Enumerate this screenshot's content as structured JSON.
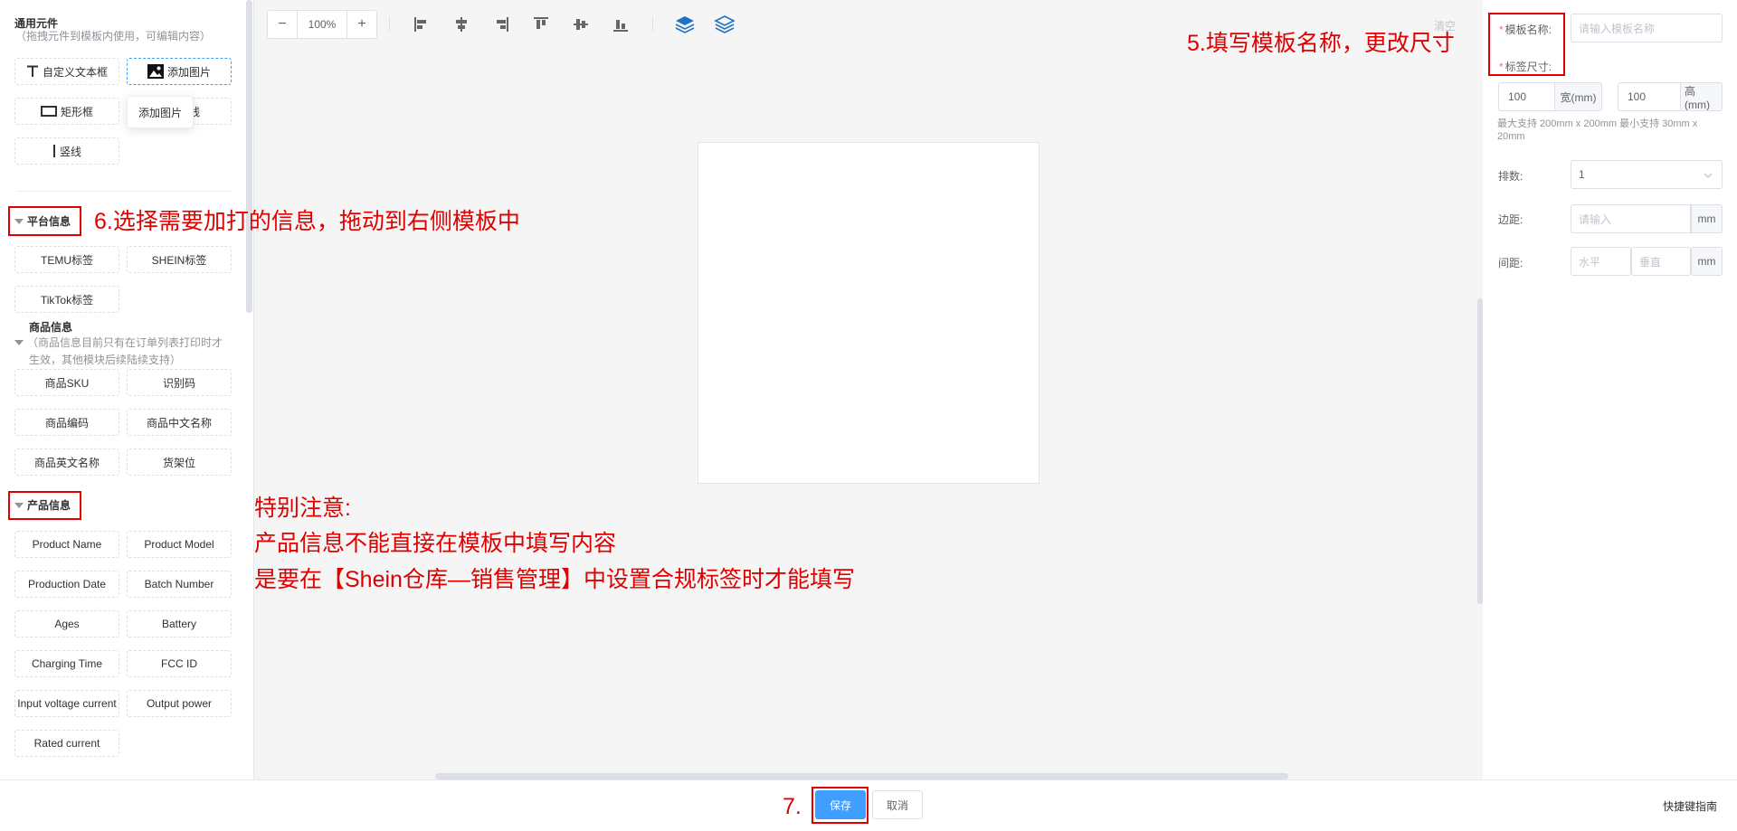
{
  "left_panel": {
    "general": {
      "title": "通用元件",
      "desc": "（拖拽元件到模板内使用，可编辑内容）",
      "items": [
        {
          "label": "自定义文本框"
        },
        {
          "label": "添加图片"
        },
        {
          "label": "矩形框"
        },
        {
          "label": "线"
        },
        {
          "label": "竖线"
        }
      ],
      "tooltip": "添加图片"
    },
    "platform": {
      "title": "平台信息",
      "items": [
        {
          "label": "TEMU标签"
        },
        {
          "label": "SHEIN标签"
        },
        {
          "label": "TikTok标签"
        }
      ]
    },
    "goods": {
      "title": "商品信息",
      "desc_line1": "（商品信息目前只有在订单列表打印时才",
      "desc_line2": "生效，其他模块后续陆续支持）",
      "items": [
        {
          "label": "商品SKU"
        },
        {
          "label": "识别码"
        },
        {
          "label": "商品编码"
        },
        {
          "label": "商品中文名称"
        },
        {
          "label": "商品英文名称"
        },
        {
          "label": "货架位"
        }
      ]
    },
    "product": {
      "title": "产品信息",
      "items": [
        {
          "label": "Product Name"
        },
        {
          "label": "Product Model"
        },
        {
          "label": "Production Date"
        },
        {
          "label": "Batch Number"
        },
        {
          "label": "Ages"
        },
        {
          "label": "Battery"
        },
        {
          "label": "Charging Time"
        },
        {
          "label": "FCC ID"
        },
        {
          "label": "Input voltage current"
        },
        {
          "label": "Output power"
        },
        {
          "label": "Rated current"
        }
      ]
    }
  },
  "toolbar": {
    "zoom_out": "−",
    "zoom": "100%",
    "zoom_in": "+",
    "icons": [
      "align-left-icon",
      "align-center-h-icon",
      "align-right-icon",
      "align-top-icon",
      "align-middle-v-icon",
      "align-bottom-icon",
      "layer-up-icon",
      "layer-down-icon"
    ],
    "clear": "清空"
  },
  "right_panel": {
    "name_label": "模板名称:",
    "name_placeholder": "请输入模板名称",
    "size_label": "标签尺寸:",
    "width_value": "100",
    "width_unit": "宽(mm)",
    "height_value": "100",
    "height_unit": "高(mm)",
    "hint": "最大支持 200mm x 200mm 最小支持 30mm x 20mm",
    "rows_label": "排数:",
    "rows_value": "1",
    "margin_label": "边距:",
    "margin_placeholder": "请输入",
    "margin_unit": "mm",
    "gap_label": "间距:",
    "gap_h_placeholder": "水平",
    "gap_v_placeholder": "垂直",
    "gap_unit": "mm"
  },
  "footer": {
    "save": "保存",
    "cancel": "取消",
    "shortcut": "快捷键指南"
  },
  "annotations": {
    "step5": "5.填写模板名称，更改尺寸",
    "step6": "6.选择需要加打的信息，拖动到右侧模板中",
    "note_title": "特别注意:",
    "note_line1": "产品信息不能直接在模板中填写内容",
    "note_line2": "是要在【Shein仓库—销售管理】中设置合规标签时才能填写",
    "step7": "7."
  },
  "colors": {
    "primary": "#409eff",
    "annotation_red": "#e00000",
    "canvas_bg": "#f5f5f5"
  }
}
